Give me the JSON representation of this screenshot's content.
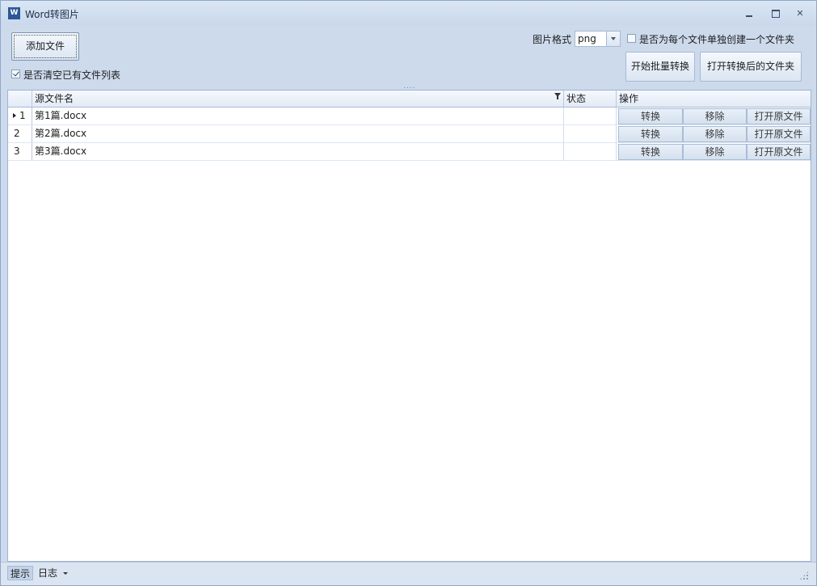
{
  "window": {
    "title": "Word转图片",
    "icon": "word-app-icon",
    "icon_letter": "W",
    "controls": [
      "minimize-icon",
      "restore-icon",
      "close-icon"
    ]
  },
  "toolbar": {
    "add_file_label": "添加文件",
    "clear_list_label": "是否清空已有文件列表",
    "clear_list_checked": true,
    "format_label": "图片格式",
    "format_value": "png",
    "create_folder_label": "是否为每个文件单独创建一个文件夹",
    "create_folder_checked": false,
    "start_batch_label": "开始批量转换",
    "open_output_folder_label": "打开转换后的文件夹",
    "splitter_glyph": "....",
    "close_glyph": "✕"
  },
  "grid": {
    "columns": {
      "name": "源文件名",
      "status": "状态",
      "ops": "操作"
    },
    "rows": [
      {
        "index": "1",
        "name": "第1篇.docx",
        "status": "",
        "current": true
      },
      {
        "index": "2",
        "name": "第2篇.docx",
        "status": "",
        "current": false
      },
      {
        "index": "3",
        "name": "第3篇.docx",
        "status": "",
        "current": false
      }
    ],
    "row_actions": {
      "convert": "转换",
      "remove": "移除",
      "open_source": "打开原文件"
    }
  },
  "statusbar": {
    "hint_tab": "提示",
    "log_tab": "日志"
  },
  "colors": {
    "chrome": "#ccdaec",
    "border": "#8ea7c9",
    "grid_background": "#ffffff",
    "accent": "#2b5797"
  }
}
